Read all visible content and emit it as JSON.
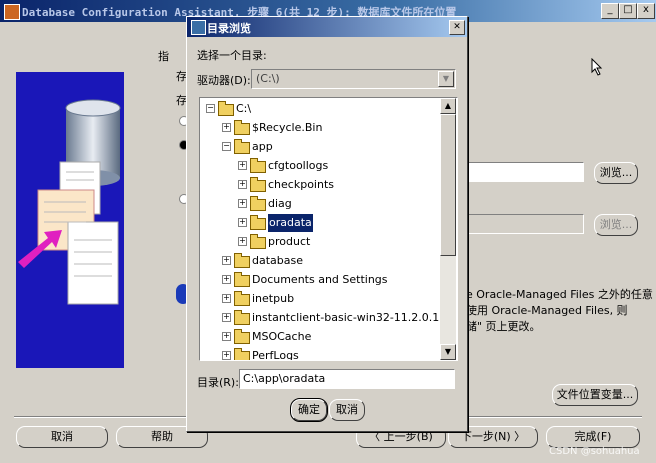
{
  "main_window": {
    "title": "Database Configuration Assistant, 步骤 6(共 12 步): 数据库文件所在位置",
    "caption_buttons": [
      "_",
      "□",
      "x"
    ],
    "partial_labels": [
      "指",
      "存",
      "存"
    ],
    "browse_label": "浏览...",
    "info_text": [
      "e Oracle-Managed Files 之外的任意",
      "使用 Oracle-Managed Files, 则",
      "储\" 页上更改。"
    ],
    "file_location_vars": "文件位置变量...",
    "bottom_buttons": {
      "cancel": "取消",
      "help": "帮助",
      "back": "上一步(B)",
      "next": "下一步(N)",
      "finish": "完成(F)"
    }
  },
  "dialog": {
    "title": "目录浏览",
    "choose_label": "选择一个目录:",
    "drive_label": "驱动器(D):",
    "drive_value": "(C:\\)",
    "tree": [
      {
        "label": "C:\\",
        "level": 0,
        "expanded": true
      },
      {
        "label": "$Recycle.Bin",
        "level": 1
      },
      {
        "label": "app",
        "level": 1,
        "expanded": true
      },
      {
        "label": "cfgtoollogs",
        "level": 2
      },
      {
        "label": "checkpoints",
        "level": 2
      },
      {
        "label": "diag",
        "level": 2
      },
      {
        "label": "oradata",
        "level": 2,
        "selected": true
      },
      {
        "label": "product",
        "level": 2
      },
      {
        "label": "database",
        "level": 1
      },
      {
        "label": "Documents and Settings",
        "level": 1
      },
      {
        "label": "inetpub",
        "level": 1
      },
      {
        "label": "instantclient-basic-win32-11.2.0.1.0",
        "level": 1
      },
      {
        "label": "MSOCache",
        "level": 1
      },
      {
        "label": "PerfLogs",
        "level": 1
      }
    ],
    "dir_label": "目录(R):",
    "dir_value": "C:\\app\\oradata",
    "ok": "确定",
    "cancel": "取消"
  },
  "watermark": "CSDN @sohuahua",
  "colors": {
    "title_bar": "#0a246a",
    "face": "#d4d0c8",
    "selection": "#0a246a",
    "art_bg": "#1a17b8"
  }
}
